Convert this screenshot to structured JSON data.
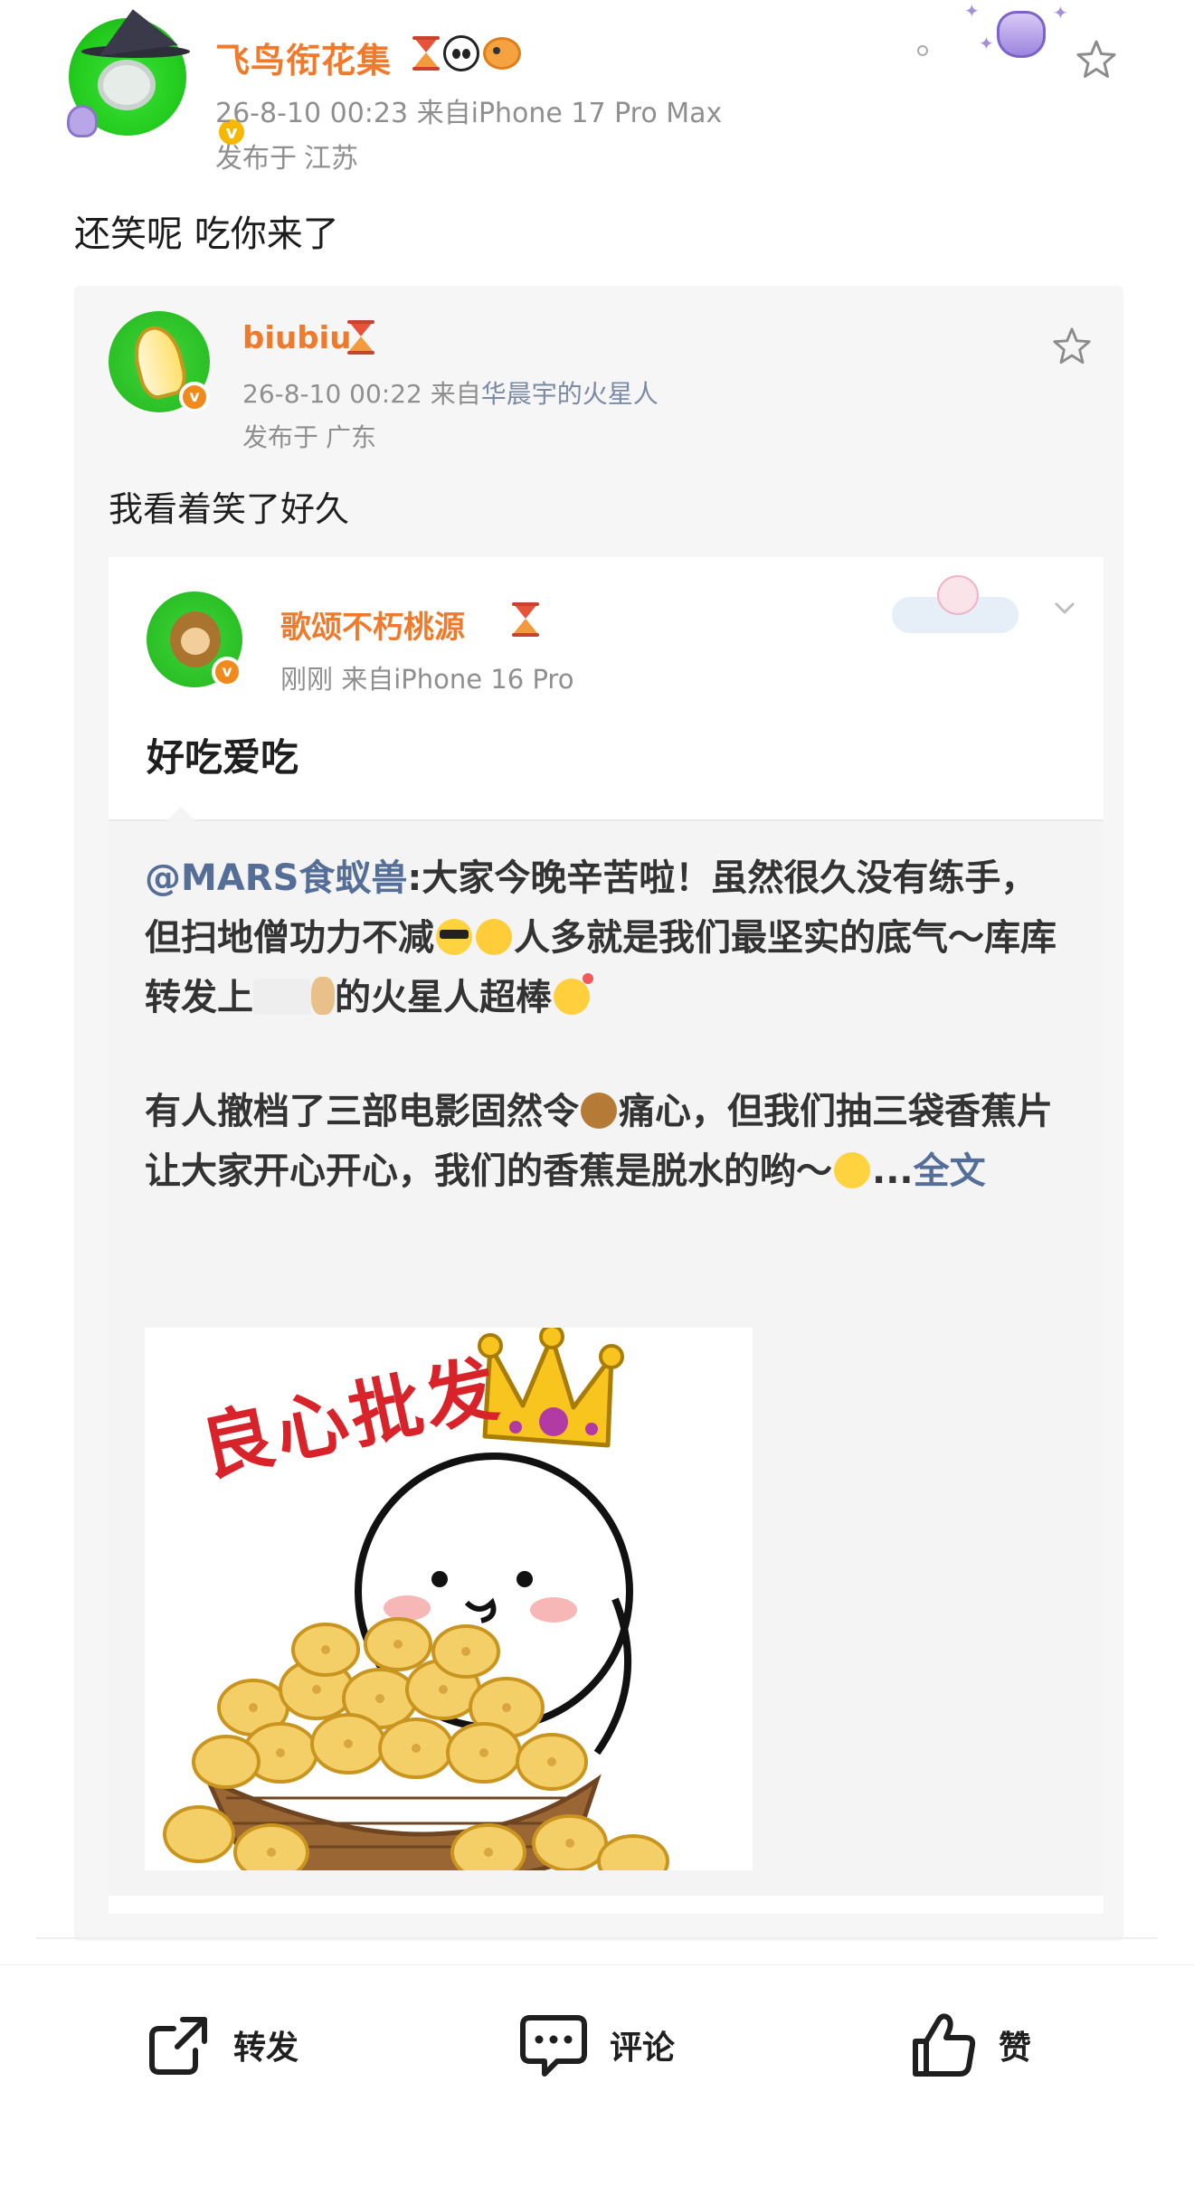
{
  "post": {
    "username": "飞鸟衔花集",
    "meta": "26-8-10 00:23  来自iPhone 17 Pro Max",
    "location_prefix": "发布于",
    "location": "江苏",
    "text": "还笑呢 吃你来了",
    "verified_mark": "v"
  },
  "repost": {
    "username": "biubiu",
    "meta_prefix": "26-8-10 00:22  来自",
    "meta_source": "华晨宇的火星人",
    "location_prefix": "发布于",
    "location": "广东",
    "text": "我看着笑了好久",
    "verified_mark": "v"
  },
  "quoted_comment": {
    "username": "歌颂不朽桃源",
    "meta": "刚刚  来自iPhone 16 Pro",
    "text": "好吃爱吃",
    "verified_mark": "v"
  },
  "reference": {
    "mention": "@MARS食蚁兽",
    "line1_a": ":大家今晚辛苦啦！虽然很久没有练手，但扫地僧功力不减",
    "line1_b": "人多就是我们最坚实的底气～库库转发上",
    "line1_c": "的火星人超棒",
    "para2_a": "有人撤档了三部电影固然令",
    "para2_b": "痛心，但我们抽三袋香蕉片让大家开心开心，我们的香蕉是脱水的哟～",
    "ellipsis": "...",
    "more_link": "全文",
    "meme_caption": "良心批发"
  },
  "actions": {
    "repost": "转发",
    "comment": "评论",
    "like": "赞"
  },
  "colors": {
    "username": "#f07a2b",
    "link": "#546e98",
    "meta": "#8f8f8f",
    "verified": "#f6b800"
  }
}
